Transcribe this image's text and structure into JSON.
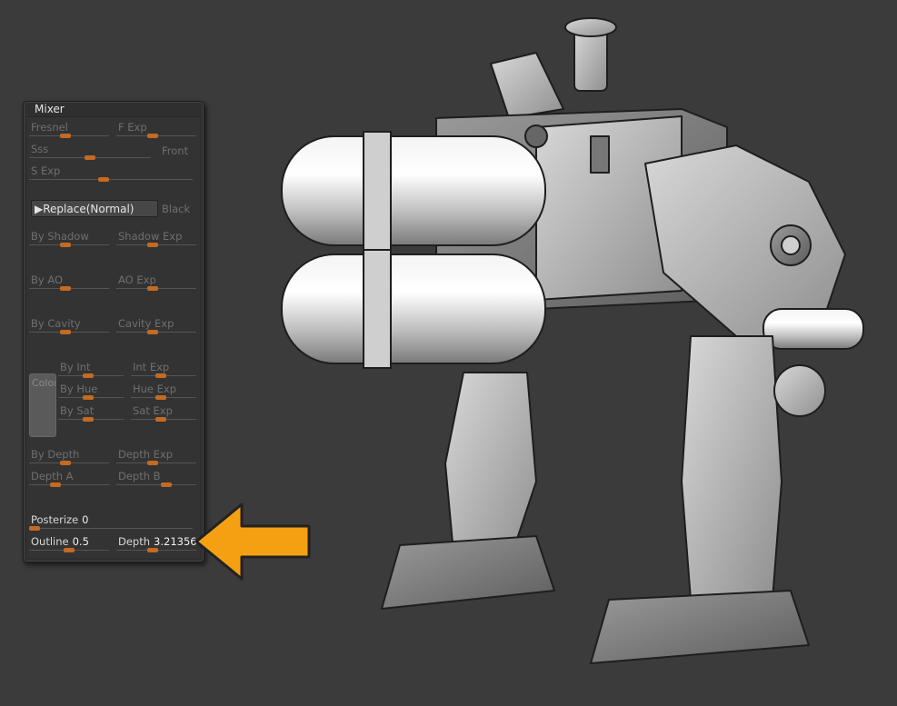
{
  "panel": {
    "title": "Mixer",
    "replace_button": "▶Replace(Normal)",
    "black_label": "Black",
    "front_label": "Front",
    "swatch_label": "Color",
    "sliders": {
      "fresnel": {
        "label": "Fresnel",
        "level": 0.45
      },
      "f_exp": {
        "label": "F Exp",
        "level": 0.45
      },
      "sss": {
        "label": "Sss",
        "level": 0.5
      },
      "s_exp": {
        "label": "S Exp",
        "level": 0.45
      },
      "by_shadow": {
        "label": "By Shadow",
        "level": 0.45
      },
      "shadow_exp": {
        "label": "Shadow Exp",
        "level": 0.45
      },
      "by_ao": {
        "label": "By AO",
        "level": 0.45
      },
      "ao_exp": {
        "label": "AO Exp",
        "level": 0.45
      },
      "by_cavity": {
        "label": "By Cavity",
        "level": 0.45
      },
      "cavity_exp": {
        "label": "Cavity Exp",
        "level": 0.45
      },
      "by_int": {
        "label": "By Int",
        "level": 0.45
      },
      "int_exp": {
        "label": "Int Exp",
        "level": 0.45
      },
      "by_hue": {
        "label": "By Hue",
        "level": 0.45
      },
      "hue_exp": {
        "label": "Hue Exp",
        "level": 0.45
      },
      "by_sat": {
        "label": "By Sat",
        "level": 0.45
      },
      "sat_exp": {
        "label": "Sat Exp",
        "level": 0.45
      },
      "by_depth": {
        "label": "By Depth",
        "level": 0.45
      },
      "depth_exp": {
        "label": "Depth Exp",
        "level": 0.45
      },
      "depth_a": {
        "label": "Depth A",
        "level": 0.3
      },
      "depth_b": {
        "label": "Depth B",
        "level": 0.65
      },
      "posterize": {
        "label": "Posterize",
        "value": "0",
        "level": 0.0
      },
      "outline": {
        "label": "Outline",
        "value": "0.5",
        "level": 0.5
      },
      "depth": {
        "label": "Depth",
        "value": "3.21356",
        "level": 0.45
      }
    }
  },
  "colors": {
    "accent": "#c46a22",
    "arrow": "#f5a012"
  },
  "icons": {
    "arrow": "arrow-left-icon",
    "viewport": "mech-robot-model"
  }
}
